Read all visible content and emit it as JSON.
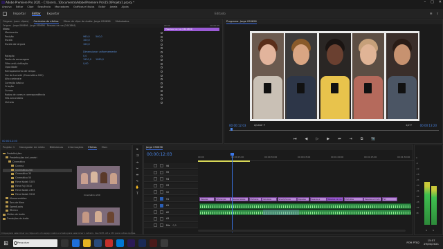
{
  "window": {
    "title": "Adobe Premiere Pro 2021 - C:\\Users\\...\\Documents\\Adobe\\Premiere Pro\\15.0\\Projeto1.prproj *",
    "controls": [
      "–",
      "□",
      "✕"
    ]
  },
  "menu": [
    "Arquivo",
    "Editar",
    "Clipe",
    "Sequência",
    "Marcadores",
    "Gráficos e títulos",
    "Exibir",
    "Janela",
    "Ajuda"
  ],
  "workspaces": {
    "items": [
      "Importar",
      "Editar",
      "Exportar"
    ],
    "active": "Editar",
    "center": "Editado"
  },
  "effect_controls": {
    "tabs": [
      "Origem: (sem clipes)",
      "Controles de efeitos",
      "Mixer de clipe de áudio: Jorge 090696",
      "Metadados"
    ],
    "active_tab": "Controles de efeitos",
    "header": "Origem - Jorge 090696 - Jorge 090696 · Pessoas na rua (2441864)",
    "clip_label": "Pessoas na rua (2441864)",
    "ruler_start": "00:00",
    "ruler_end": "00:00:05",
    "section": "Vídeo",
    "rows": [
      {
        "label": "Movimento",
        "v1": "",
        "v2": ""
      },
      {
        "label": "Posição",
        "v1": "960,0",
        "v2": "540,0"
      },
      {
        "label": "Escala",
        "v1": "100,0",
        "v2": ""
      },
      {
        "label": "Escala da largura",
        "v1": "100,0",
        "v2": ""
      },
      {
        "label": "",
        "v1": "",
        "v2": ""
      },
      {
        "label": "",
        "v1": "Dimensionar uniformemente",
        "v2": ""
      },
      {
        "label": "Rotação",
        "v1": "0,0",
        "v2": ""
      },
      {
        "label": "Ponto de ancoragem",
        "v1": "1920,0",
        "v2": "1080,0"
      },
      {
        "label": "Filtro anti-cintilação",
        "v1": "0,00",
        "v2": ""
      },
      {
        "label": "Opacidade",
        "v1": "",
        "v2": ""
      },
      {
        "label": "Remapeamento de tempo",
        "v1": "",
        "v2": ""
      },
      {
        "label": "Cor de Lumetri (Cinemático 200)",
        "v1": "",
        "v2": ""
      },
      {
        "label": "Alto contraste",
        "v1": "",
        "v2": ""
      },
      {
        "label": "Correção básica",
        "v1": "",
        "v2": ""
      },
      {
        "label": "Criação",
        "v1": "",
        "v2": ""
      },
      {
        "label": "Curvas",
        "v1": "",
        "v2": ""
      },
      {
        "label": "Rodas de cores e correspondência",
        "v1": "",
        "v2": ""
      },
      {
        "label": "HSL secundário",
        "v1": "",
        "v2": ""
      },
      {
        "label": "Vinheta",
        "v1": "",
        "v2": ""
      }
    ],
    "timecode": "00:00:12:03"
  },
  "program": {
    "title": "Programa: Jorge 090696",
    "timecode_left": "00:00:12:03",
    "fit": "Ajustar",
    "quality": "1/2",
    "timecode_right": "00:00:13:20",
    "transport": [
      "⏭",
      "◀",
      "▷",
      "▶",
      "⏮",
      "⇥",
      "⧉",
      "📷"
    ]
  },
  "project": {
    "tabs": [
      "Projeto: 1",
      "Navegador de mídia",
      "Bibliotecas",
      "Informações",
      "Efeitos",
      "Marc"
    ],
    "active_tab": "Efeitos",
    "tree": [
      {
        "label": "Predefinições",
        "indent": 0,
        "sel": false
      },
      {
        "label": "Predefinições de Lumetri",
        "indent": 1,
        "sel": false
      },
      {
        "label": "Cinemático",
        "indent": 2,
        "sel": false
      },
      {
        "label": "Cinema",
        "indent": 3,
        "sel": false
      },
      {
        "label": "Cinemático 200",
        "indent": 3,
        "sel": true
      },
      {
        "label": "Cinemático 30",
        "indent": 3,
        "sel": false
      },
      {
        "label": "Cinemático 50",
        "indent": 3,
        "sel": false
      },
      {
        "label": "Filme Kodak 5205",
        "indent": 3,
        "sel": false
      },
      {
        "label": "Filme Fuji 3510",
        "indent": 3,
        "sel": false
      },
      {
        "label": "Filme Kodak 2393",
        "indent": 3,
        "sel": false
      },
      {
        "label": "Filme Kodak 5218",
        "indent": 3,
        "sel": false
      },
      {
        "label": "Monocromático",
        "indent": 1,
        "sel": false
      },
      {
        "label": "Tons de filme",
        "indent": 1,
        "sel": false
      },
      {
        "label": "SpeedLooks",
        "indent": 1,
        "sel": false
      },
      {
        "label": "Técnico",
        "indent": 1,
        "sel": false
      },
      {
        "label": "Efeitos de áudio",
        "indent": 0,
        "sel": false
      },
      {
        "label": "Transições de áudio",
        "indent": 0,
        "sel": false
      }
    ],
    "thumb_label": "Cinemático 200"
  },
  "timeline": {
    "tab": "Jorge 090696",
    "timecode": "00:00:12:03",
    "ticks": [
      "00:00",
      "00:00:15:00",
      "00:00:30:00",
      "00:00:45:00",
      "00:01:00:00",
      "00:01:15:00",
      "00:01:30:00"
    ],
    "tracks": [
      {
        "name": "V6",
        "kind": "v"
      },
      {
        "name": "V5",
        "kind": "v"
      },
      {
        "name": "V4",
        "kind": "v"
      },
      {
        "name": "V3",
        "kind": "v"
      },
      {
        "name": "V2",
        "kind": "v"
      },
      {
        "name": "V1",
        "kind": "v"
      },
      {
        "name": "A1",
        "kind": "a"
      },
      {
        "name": "A2",
        "kind": "a"
      },
      {
        "name": "A3",
        "kind": "a"
      },
      {
        "name": "Mix",
        "kind": "m"
      }
    ],
    "mix_value": "0,0",
    "v1_clips": [
      "Pessoas",
      "Diferenças",
      "Pessoas felizes",
      "Mulheres",
      "Celulares mundo",
      "Smartphones",
      "Rapazes",
      "Pessoas e celular",
      "Pessoas na rua",
      "Multidões",
      "Pessoas sorrindo",
      "Fim"
    ]
  },
  "meter": {
    "scale": [
      "0",
      "-6",
      "-12",
      "-18",
      "-24",
      "-30",
      "-36",
      "-42",
      "-48",
      "-54",
      "dB"
    ],
    "levels": [
      0.62,
      0.56
    ],
    "labels": [
      "S",
      "S"
    ]
  },
  "status": "Clique para selecionar ou clique em um espaço vazio e arraste para selecionar o letreiro. Use Shift, Alt e Ctrl para outras opções.",
  "taskbar": {
    "search": "Pesquisar",
    "lang": "POR PTB2",
    "time": "15:57",
    "date": "29/04/2021"
  },
  "colors": {
    "accent": "#3a6ee8",
    "clip_video": "#b98ad6",
    "clip_audio": "#2e8a44",
    "ec_clip": "#9b5bd6"
  }
}
